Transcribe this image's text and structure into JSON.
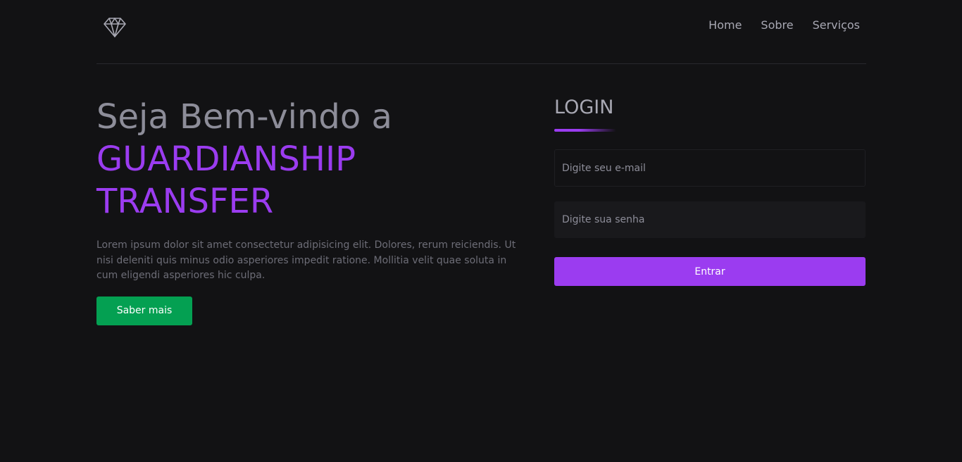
{
  "header": {
    "logo_icon": "diamond-icon",
    "nav": [
      {
        "label": "Home"
      },
      {
        "label": "Sobre"
      },
      {
        "label": "Serviços"
      }
    ]
  },
  "hero": {
    "title_line": "Seja Bem-vindo a",
    "brand": "GUARDIANSHIP TRANSFER",
    "description": "Lorem ipsum dolor sit amet consectetur adipisicing elit. Dolores, rerum reiciendis. Ut nisi deleniti quis minus odio asperiores impedit ratione. Mollitia velit quae soluta in cum eligendi asperiores hic culpa.",
    "cta_label": "Saber mais"
  },
  "login": {
    "title": "LOGIN",
    "email_placeholder": "Digite seu e-mail",
    "password_placeholder": "Digite sua senha",
    "submit_label": "Entrar"
  },
  "colors": {
    "background": "#121214",
    "accent": "#9b3cf0",
    "cta": "#04a052",
    "text_muted": "#8d8d99"
  }
}
